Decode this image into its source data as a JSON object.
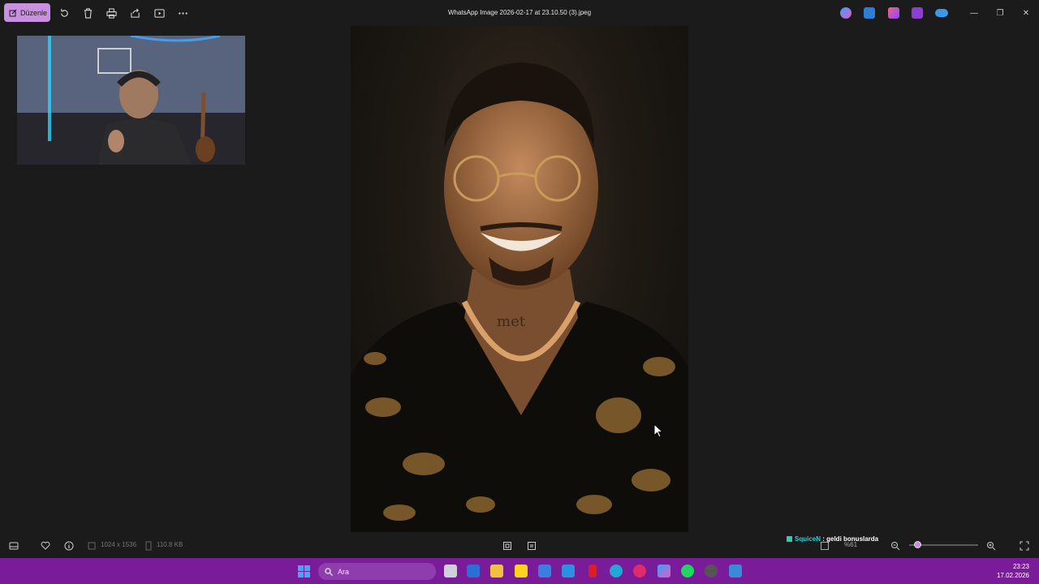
{
  "titlebar": {
    "edit_label": "Düzenle",
    "title": "WhatsApp Image 2026-02-17 at 23.10.50 (3).jpeg",
    "icons": [
      "rotate-icon",
      "delete-icon",
      "print-icon",
      "share-icon",
      "slideshow-icon",
      "more-icon"
    ],
    "apps": [
      "copilot-icon",
      "designer-icon",
      "clipchamp-icon",
      "editor-icon",
      "onedrive-icon"
    ],
    "window_controls": [
      "minimize-icon",
      "restore-icon",
      "close-icon"
    ]
  },
  "photo": {
    "shirt_text": "met"
  },
  "bottombar": {
    "dimensions": "1024 x 1536",
    "filesize": "110.8 KB",
    "zoom_label": "%61",
    "zoom_level_percent": 61
  },
  "chat": {
    "user": "SquiceN",
    "sep": " : ",
    "message": "geldi bonuslarda"
  },
  "taskbar": {
    "search_placeholder": "Ara",
    "time": "23:23",
    "date": "17.02.2026"
  },
  "colors": {
    "accent": "#c98fe0",
    "taskbar": "#7a1b9a",
    "background": "#1b1b1b"
  }
}
